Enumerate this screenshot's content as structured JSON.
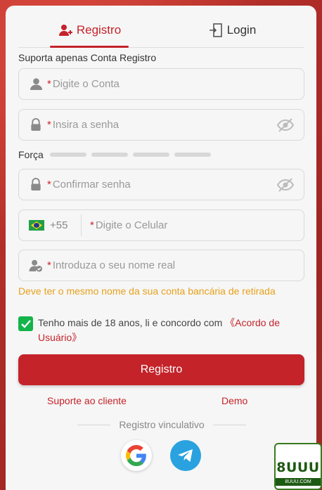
{
  "tabs": [
    {
      "label": "Registro",
      "icon": "user-plus-icon",
      "active": true
    },
    {
      "label": "Login",
      "icon": "login-door-icon",
      "active": false
    }
  ],
  "form": {
    "subtitle": "Suporta apenas Conta Registro",
    "required_mark": "*",
    "account_placeholder": "Digite o Conta",
    "password_placeholder": "Insira a senha",
    "strength_label": "Força",
    "confirm_placeholder": "Confirmar senha",
    "country_code": "+55",
    "phone_placeholder": "Digite o Celular",
    "realname_placeholder": "Introduza o seu nome real",
    "realname_hint": "Deve ter o mesmo nome da sua conta bancária de retirada",
    "agree_text": "Tenho mais de 18 anos, li e concordo com ",
    "agree_link": "《Acordo de Usuário》",
    "agree_checked": true,
    "submit_label": "Registro"
  },
  "links": {
    "support": "Suporte ao cliente",
    "demo": "Demo"
  },
  "social": {
    "divider_label": "Registro vinculativo",
    "providers": [
      "google-icon",
      "telegram-icon"
    ]
  },
  "logo": {
    "main": "8UUU",
    "sub": "8UUU.COM"
  },
  "colors": {
    "accent": "#c4232a",
    "hint": "#e7a11b",
    "check": "#13b44a",
    "telegram": "#2aa2e0"
  }
}
